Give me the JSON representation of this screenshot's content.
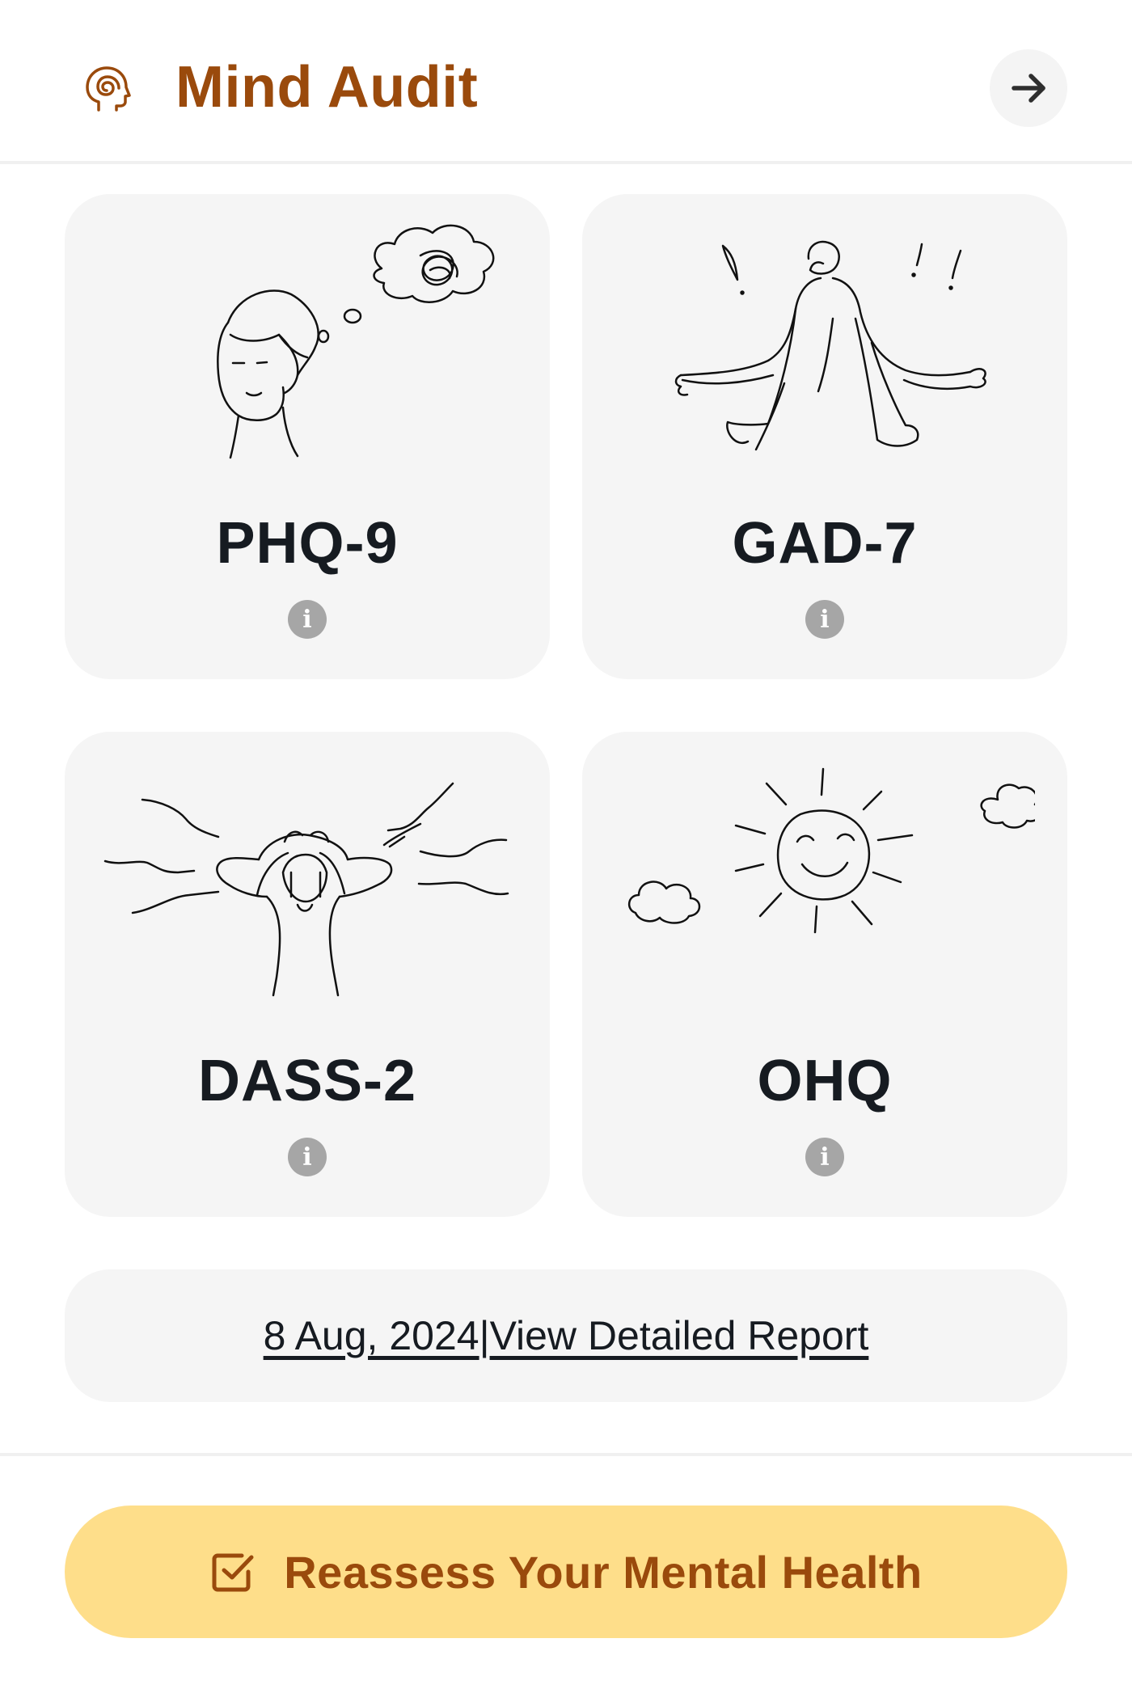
{
  "header": {
    "title": "Mind Audit",
    "brand_icon": "head-spiral-icon",
    "action_icon": "arrow-right-icon"
  },
  "assessments": [
    {
      "title": "PHQ-9",
      "illustration": "thinking-person-icon",
      "info_icon": "info-icon"
    },
    {
      "title": "GAD-7",
      "illustration": "anxious-person-icon",
      "info_icon": "info-icon"
    },
    {
      "title": "DASS-2",
      "illustration": "stressed-person-icon",
      "info_icon": "info-icon"
    },
    {
      "title": "OHQ",
      "illustration": "smiling-sun-icon",
      "info_icon": "info-icon"
    }
  ],
  "report": {
    "date": "8 Aug, 2024",
    "separator": "|",
    "link_label": "View Detailed Report"
  },
  "cta": {
    "label": "Reassess Your Mental Health",
    "icon": "checkbox-icon"
  },
  "colors": {
    "brand": "#9a4a0c",
    "card_bg": "#f5f5f5",
    "cta_bg": "#fede8a",
    "text": "#161b21",
    "info_icon": "#a6a6a6"
  }
}
